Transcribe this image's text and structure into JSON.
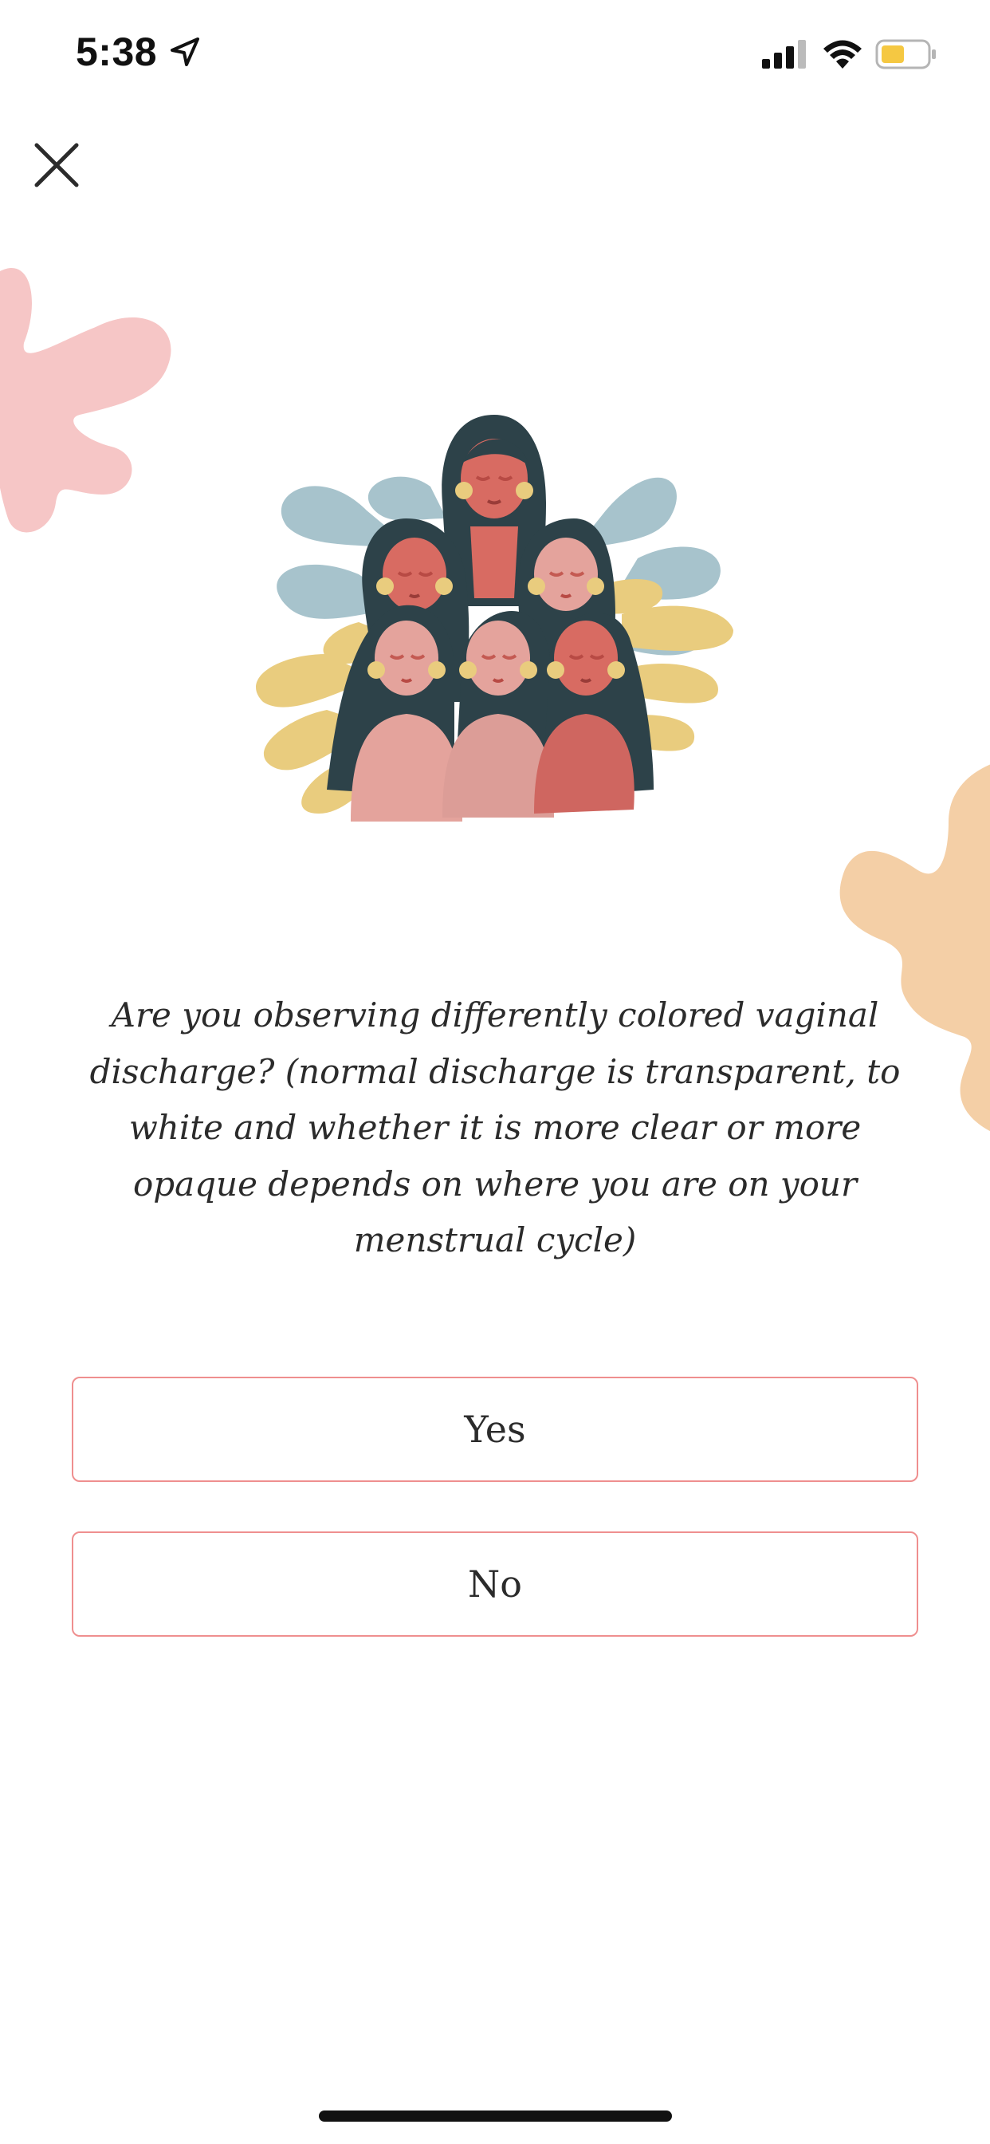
{
  "status_bar": {
    "time": "5:38",
    "icons": [
      "location-arrow-icon",
      "cellular-signal-icon",
      "wifi-icon",
      "battery-icon"
    ],
    "battery_color": "#f5c842"
  },
  "header": {
    "close_icon": "close-icon"
  },
  "illustration": {
    "name": "group-of-women-illustration"
  },
  "question": {
    "text": "Are you observing differently colored vaginal discharge? (normal discharge is transparent, to white and whether it is more clear or more opaque depends on where you are on your menstrual cycle)"
  },
  "answers": [
    {
      "label": "Yes"
    },
    {
      "label": "No"
    }
  ],
  "colors": {
    "button_border": "#ef8f8f",
    "blob_pink": "#f6c6c6",
    "blob_peach": "#f4cfa6",
    "leaf_blue": "#a7c3cc",
    "leaf_yellow": "#e9cc7e",
    "hair": "#2d4249",
    "skin": "#d86b62"
  }
}
